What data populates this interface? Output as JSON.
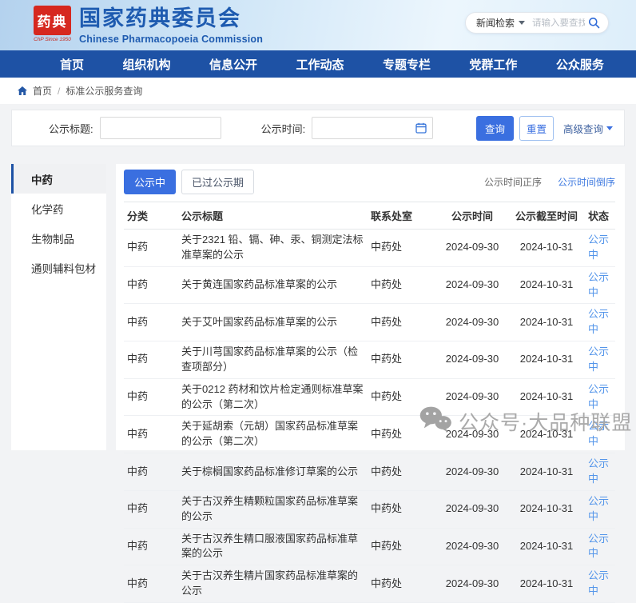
{
  "header": {
    "title": "国家药典委员会",
    "subtitle": "Chinese Pharmacopoeia Commission",
    "seal_text": "药典",
    "seal_caption": "ChP  Since 1950",
    "search": {
      "category": "新闻检索",
      "placeholder": "请输入要查找的关键字"
    }
  },
  "nav": {
    "items": [
      "首页",
      "组织机构",
      "信息公开",
      "工作动态",
      "专题专栏",
      "党群工作",
      "公众服务"
    ]
  },
  "breadcrumb": {
    "home": "首页",
    "separator": "/",
    "current": "标准公示服务查询"
  },
  "filter": {
    "title_label": "公示标题:",
    "time_label": "公示时间:",
    "title_value": "",
    "time_value": "",
    "search_button": "查询",
    "reset_button": "重置",
    "advanced_button": "高级查询"
  },
  "sidebar": {
    "items": [
      {
        "label": "中药",
        "active": true
      },
      {
        "label": "化学药",
        "active": false
      },
      {
        "label": "生物制品",
        "active": false
      },
      {
        "label": "通则辅料包材",
        "active": false
      }
    ]
  },
  "toolbar": {
    "tabs": [
      {
        "label": "公示中",
        "active": true
      },
      {
        "label": "已过公示期",
        "active": false
      }
    ],
    "sort_links": [
      {
        "label": "公示时间正序",
        "active": false
      },
      {
        "label": "公示时间倒序",
        "active": true
      }
    ]
  },
  "table": {
    "columns": [
      "分类",
      "公示标题",
      "联系处室",
      "公示时间",
      "公示截至时间",
      "状态"
    ],
    "rows": [
      {
        "category": "中药",
        "title": "关于2321 铅、镉、砷、汞、铜测定法标准草案的公示",
        "office": "中药处",
        "publish_date": "2024-09-30",
        "end_date": "2024-10-31",
        "status": "公示中"
      },
      {
        "category": "中药",
        "title": "关于黄连国家药品标准草案的公示",
        "office": "中药处",
        "publish_date": "2024-09-30",
        "end_date": "2024-10-31",
        "status": "公示中"
      },
      {
        "category": "中药",
        "title": "关于艾叶国家药品标准草案的公示",
        "office": "中药处",
        "publish_date": "2024-09-30",
        "end_date": "2024-10-31",
        "status": "公示中"
      },
      {
        "category": "中药",
        "title": "关于川芎国家药品标准草案的公示（检查项部分）",
        "office": "中药处",
        "publish_date": "2024-09-30",
        "end_date": "2024-10-31",
        "status": "公示中"
      },
      {
        "category": "中药",
        "title": "关于0212 药材和饮片检定通则标准草案的公示（第二次）",
        "office": "中药处",
        "publish_date": "2024-09-30",
        "end_date": "2024-10-31",
        "status": "公示中"
      },
      {
        "category": "中药",
        "title": "关于延胡索（元胡）国家药品标准草案的公示（第二次）",
        "office": "中药处",
        "publish_date": "2024-09-30",
        "end_date": "2024-10-31",
        "status": "公示中"
      },
      {
        "category": "中药",
        "title": "关于棕榈国家药品标准修订草案的公示",
        "office": "中药处",
        "publish_date": "2024-09-30",
        "end_date": "2024-10-31",
        "status": "公示中"
      },
      {
        "category": "中药",
        "title": "关于古汉养生精颗粒国家药品标准草案的公示",
        "office": "中药处",
        "publish_date": "2024-09-30",
        "end_date": "2024-10-31",
        "status": "公示中"
      },
      {
        "category": "中药",
        "title": "关于古汉养生精口服液国家药品标准草案的公示",
        "office": "中药处",
        "publish_date": "2024-09-30",
        "end_date": "2024-10-31",
        "status": "公示中"
      },
      {
        "category": "中药",
        "title": "关于古汉养生精片国家药品标准草案的公示",
        "office": "中药处",
        "publish_date": "2024-09-30",
        "end_date": "2024-10-31",
        "status": "公示中"
      }
    ]
  },
  "watermark": {
    "text": "公众号·大品种联盟"
  },
  "colors": {
    "nav_bg": "#1e52a5",
    "primary_blue": "#3a6fe0",
    "status_blue": "#5596ea",
    "title_blue": "#1e5bb0",
    "seal_red": "#d6281f"
  }
}
